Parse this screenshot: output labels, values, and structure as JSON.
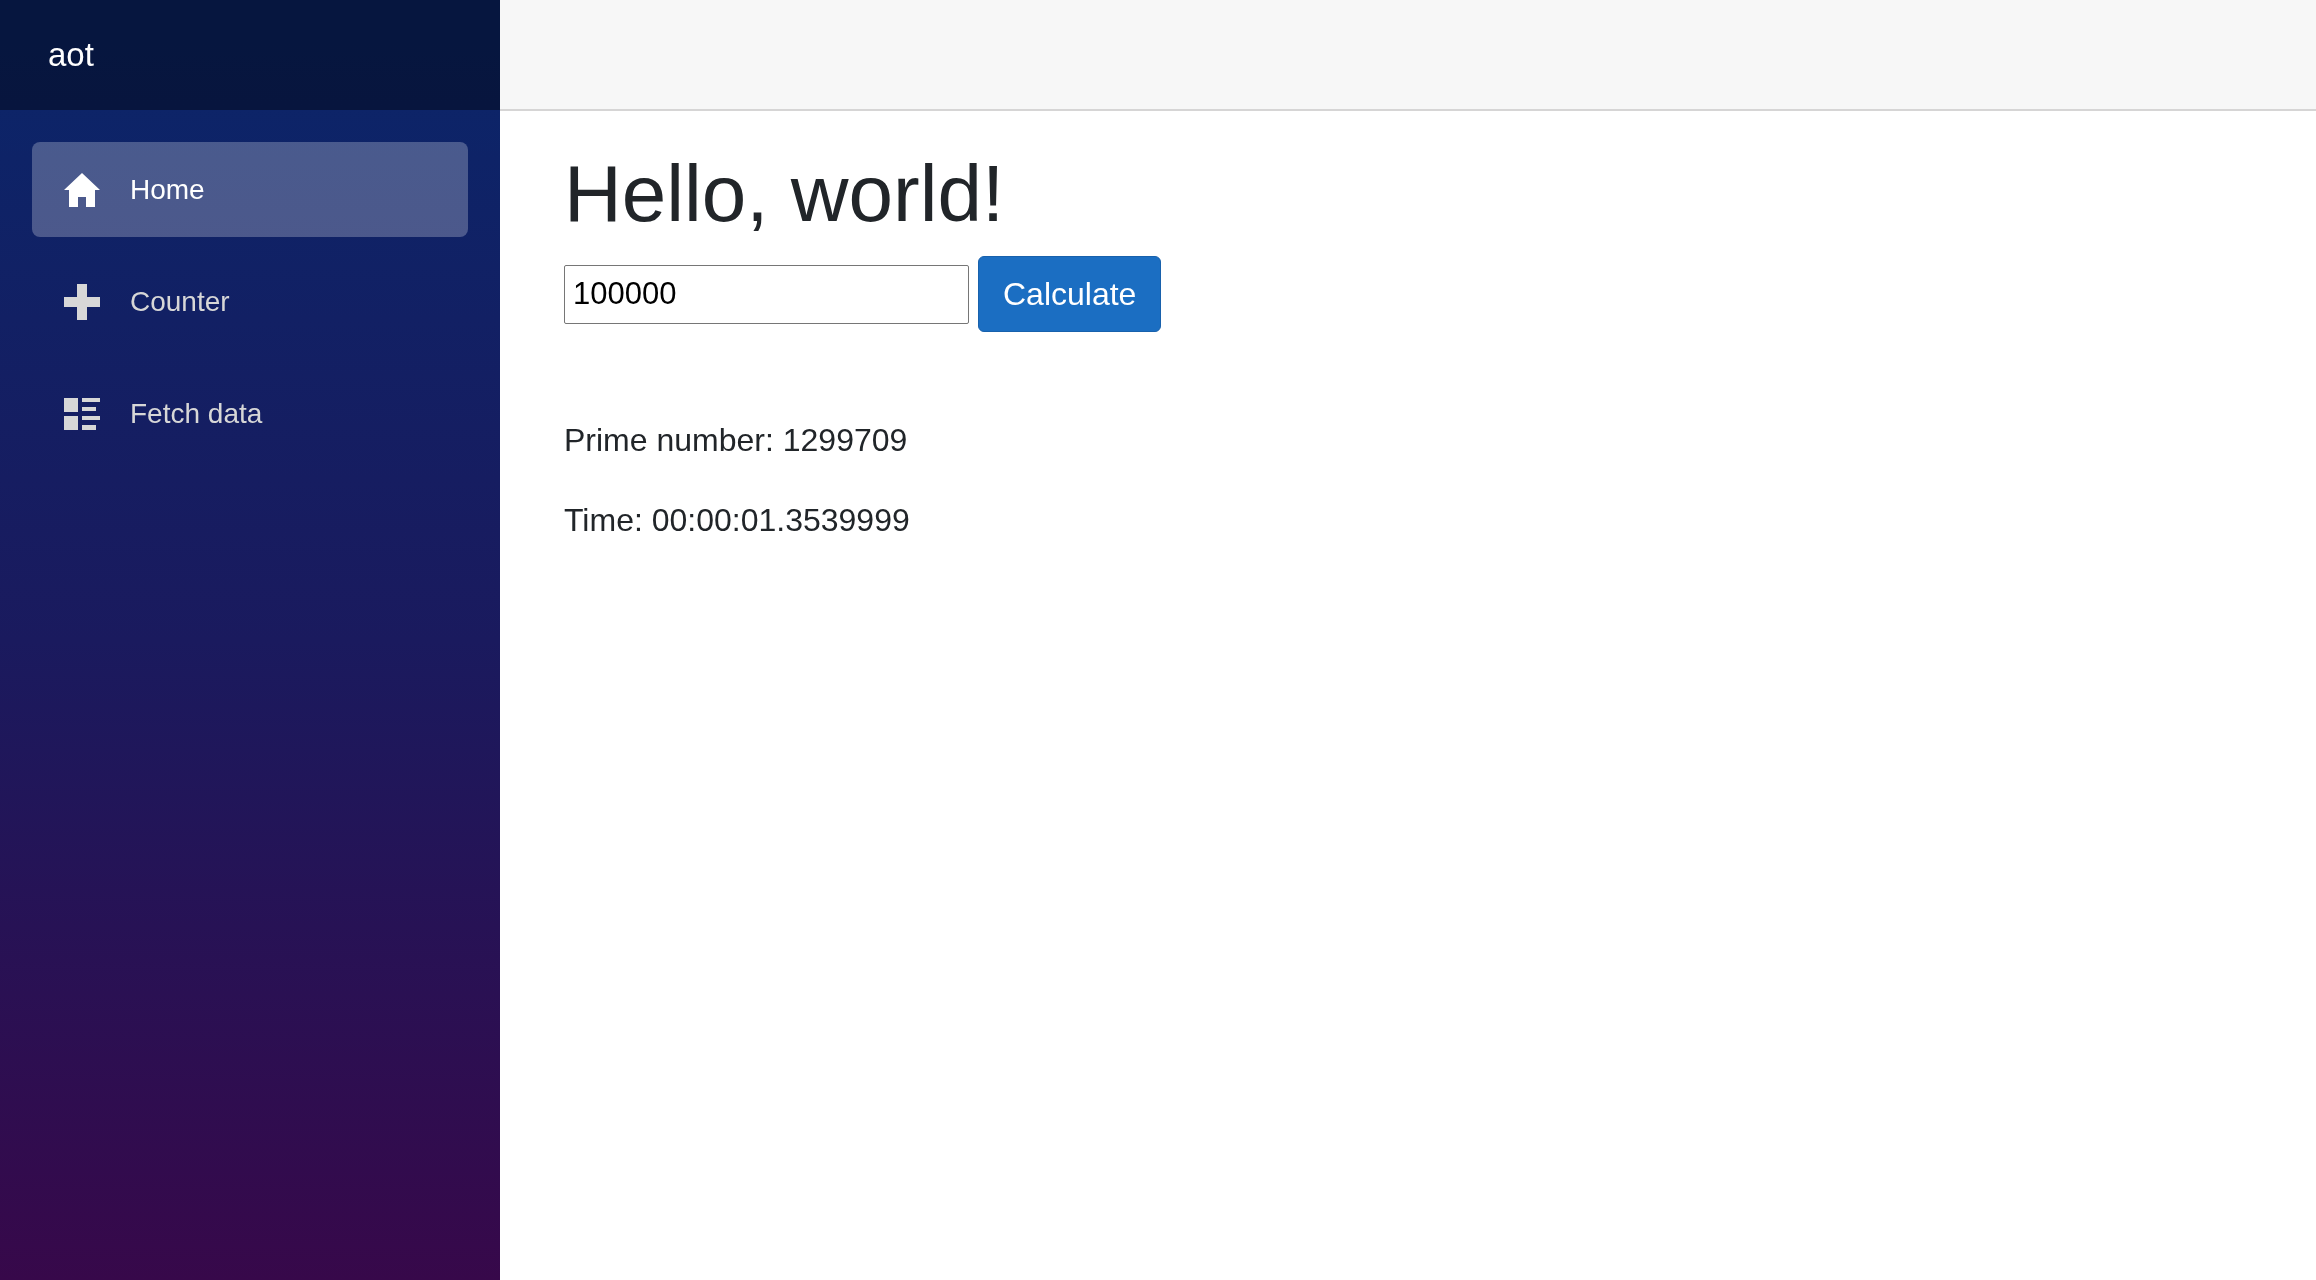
{
  "brand": "aot",
  "nav": [
    {
      "label": "Home",
      "selected": true
    },
    {
      "label": "Counter",
      "selected": false
    },
    {
      "label": "Fetch data",
      "selected": false
    }
  ],
  "heading": "Hello, world!",
  "input": {
    "value": "100000"
  },
  "button": "Calculate",
  "results": [
    "Prime number: 1299709",
    "Time: 00:00:01.3539999"
  ]
}
